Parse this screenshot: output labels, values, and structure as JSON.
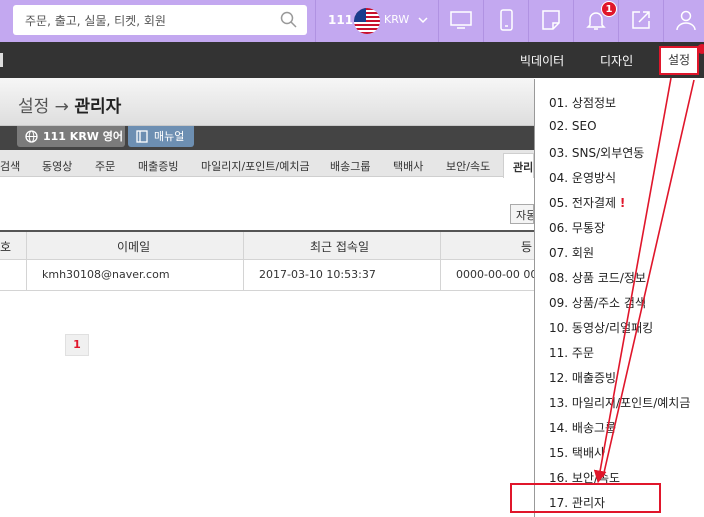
{
  "topbar": {
    "search_placeholder": "주문, 출고, 실물, 티켓, 회원",
    "region_number": "111",
    "currency": "KRW",
    "notification_count": "1"
  },
  "navbar": {
    "items": [
      "빅데이터",
      "디자인"
    ],
    "active": "설정"
  },
  "page": {
    "breadcrumb_parent": "설정 →",
    "breadcrumb_current": "관리자"
  },
  "subbar": {
    "site_label": "111 KRW 영어",
    "manual_label": "매뉴얼"
  },
  "tabs": [
    {
      "label": "검색"
    },
    {
      "label": "동영상"
    },
    {
      "label": "주문"
    },
    {
      "label": "매출증빙"
    },
    {
      "label": "마일리지/포인트/예치금"
    },
    {
      "label": "배송그룹"
    },
    {
      "label": "택배사"
    },
    {
      "label": "보안/속도"
    }
  ],
  "active_tab": "관리자",
  "auto_button": "자동",
  "table": {
    "headers": [
      "호",
      "이메일",
      "최근 접속일",
      "등"
    ],
    "rows": [
      [
        "kmh30108@naver.com",
        "2017-03-10 10:53:37",
        "0000-00-00 00"
      ]
    ]
  },
  "pagination": {
    "current": "1"
  },
  "menu": {
    "items": [
      "01. 상점정보",
      "02. SEO",
      "03. SNS/외부연동",
      "04. 운영방식",
      "05. 전자결제",
      "06. 무통장",
      "07. 회원",
      "08. 상품 코드/정보",
      "09. 상품/주소 검색",
      "10. 동영상/리얼패킹",
      "11. 주문",
      "12. 매출증빙",
      "13. 마일리지/포인트/예치금",
      "14. 배송그룹",
      "15. 택배사",
      "16. 보안/속도",
      "17. 관리자"
    ],
    "warning_mark": "!"
  },
  "colors": {
    "topbar": "#c3a8f0",
    "navbar": "#333333",
    "accent_red": "#e0162b"
  }
}
